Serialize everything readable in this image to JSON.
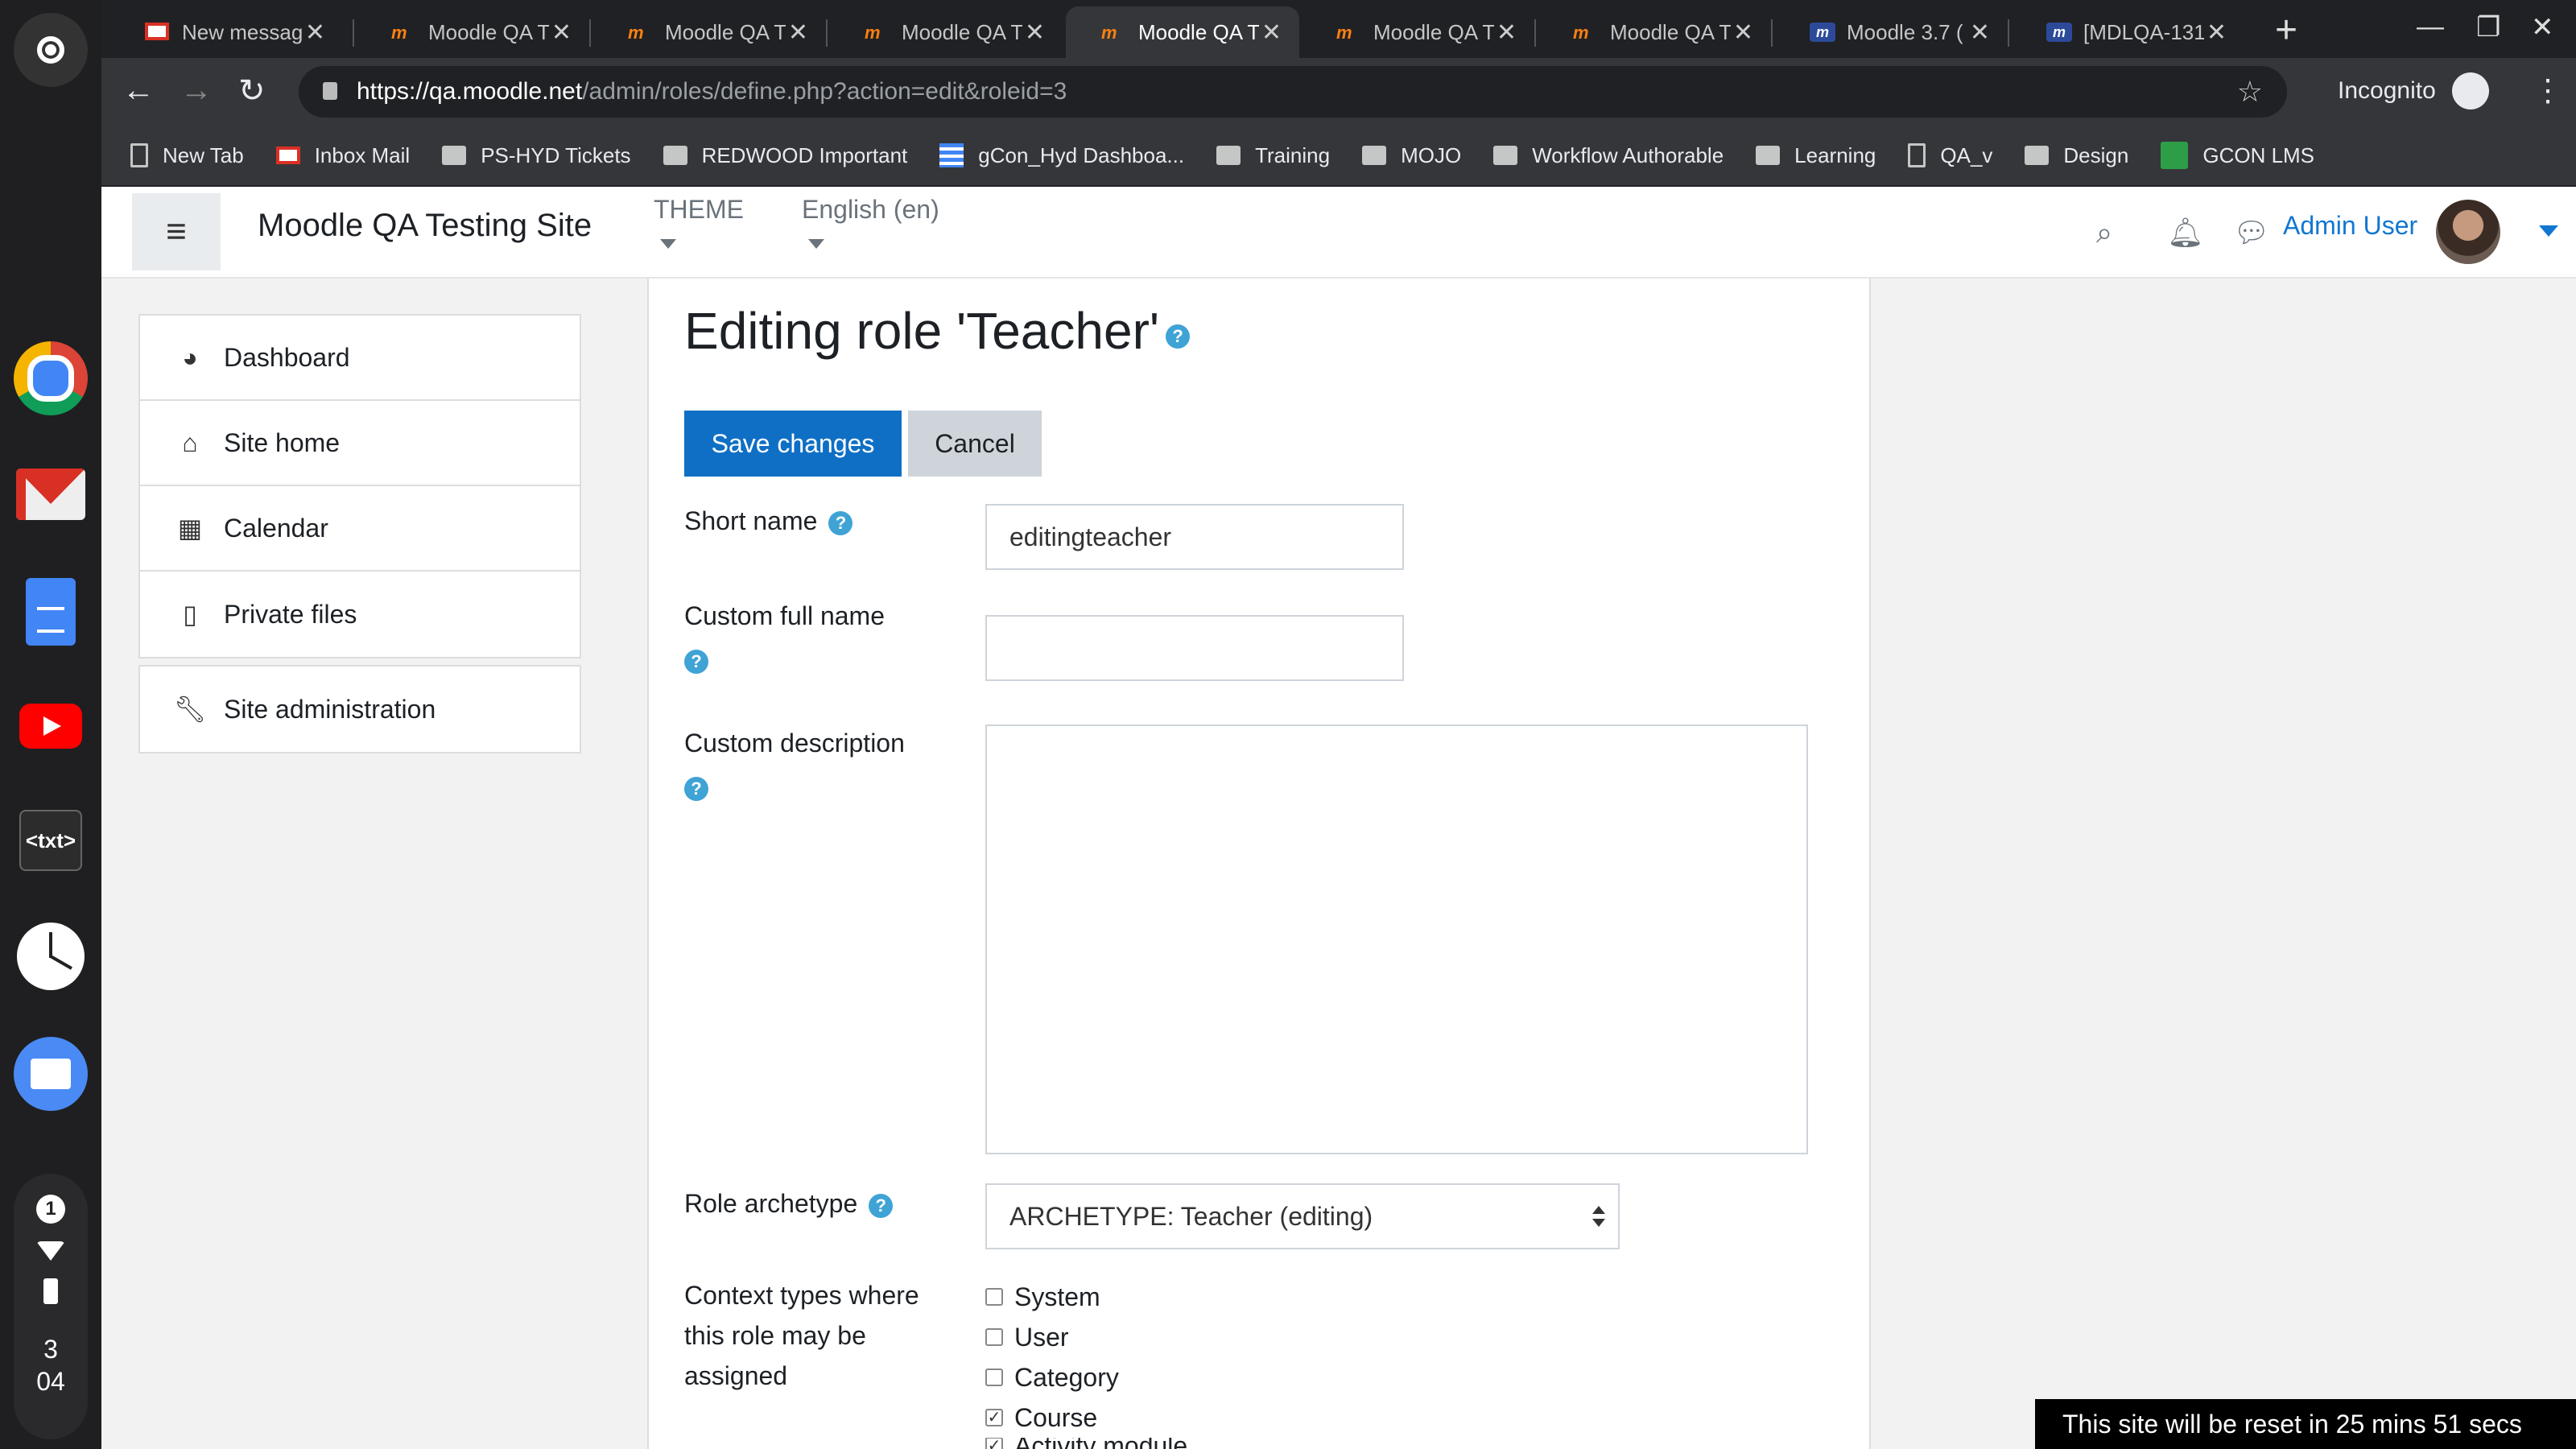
{
  "shelf": {
    "apps": [
      "launcher-icon",
      "chrome-icon",
      "gmail-icon",
      "docs-icon",
      "youtube-icon",
      "text-editor-icon",
      "clock-icon",
      "files-icon"
    ],
    "text_app_label": "<txt>",
    "notification_count": "1",
    "time_hour": "3",
    "time_minute": "04"
  },
  "browser": {
    "tabs": [
      {
        "title": "New message",
        "icon": "gmail-icon"
      },
      {
        "title": "Moodle QA T",
        "icon": "moodle-icon"
      },
      {
        "title": "Moodle QA T",
        "icon": "moodle-icon"
      },
      {
        "title": "Moodle QA T",
        "icon": "moodle-icon"
      },
      {
        "title": "Moodle QA T",
        "icon": "moodle-icon",
        "active": true
      },
      {
        "title": "Moodle QA T",
        "icon": "moodle-icon"
      },
      {
        "title": "Moodle QA T",
        "icon": "moodle-icon"
      },
      {
        "title": "Moodle 3.7 (",
        "icon": "moodle-tracker-icon"
      },
      {
        "title": "[MDLQA-131",
        "icon": "moodle-tracker-icon"
      }
    ],
    "url_host": "https://qa.moodle.net",
    "url_path": "/admin/roles/define.php?action=edit&roleid=3",
    "incognito_label": "Incognito",
    "bookmarks": [
      {
        "label": "New Tab",
        "icon": "page-icon"
      },
      {
        "label": "Inbox Mail",
        "icon": "gmail-icon"
      },
      {
        "label": "PS-HYD Tickets",
        "icon": "folder-icon"
      },
      {
        "label": "REDWOOD Important",
        "icon": "folder-icon"
      },
      {
        "label": "gCon_Hyd Dashboa...",
        "icon": "dashboard-icon"
      },
      {
        "label": "Training",
        "icon": "folder-icon"
      },
      {
        "label": "MOJO",
        "icon": "folder-icon"
      },
      {
        "label": "Workflow Authorable",
        "icon": "folder-icon"
      },
      {
        "label": "Learning",
        "icon": "folder-icon"
      },
      {
        "label": "QA_v",
        "icon": "page-icon"
      },
      {
        "label": "Design",
        "icon": "folder-icon"
      },
      {
        "label": "GCON LMS",
        "icon": "lms-icon"
      }
    ]
  },
  "moodle": {
    "site_name": "Moodle QA Testing Site",
    "theme_menu": "THEME",
    "language_menu": "English (en)",
    "user_name": "Admin User",
    "left_nav": {
      "main": [
        {
          "label": "Dashboard",
          "icon": "dashboard-icon"
        },
        {
          "label": "Site home",
          "icon": "home-icon"
        },
        {
          "label": "Calendar",
          "icon": "calendar-icon"
        },
        {
          "label": "Private files",
          "icon": "file-icon"
        }
      ],
      "admin": {
        "label": "Site administration",
        "icon": "wrench-icon"
      }
    },
    "form": {
      "heading": "Editing role 'Teacher'",
      "save_label": "Save changes",
      "cancel_label": "Cancel",
      "short_name_label": "Short name",
      "short_name_value": "editingteacher",
      "full_name_label": "Custom full name",
      "full_name_value": "",
      "description_label": "Custom description",
      "description_value": "",
      "archetype_label": "Role archetype",
      "archetype_value": "ARCHETYPE: Teacher (editing)",
      "context_label": "Context types where this role may be assigned",
      "contexts": [
        {
          "label": "System",
          "checked": false
        },
        {
          "label": "User",
          "checked": false
        },
        {
          "label": "Category",
          "checked": false
        },
        {
          "label": "Course",
          "checked": true
        },
        {
          "label": "Activity module",
          "checked": true
        }
      ]
    },
    "reset_notice": "This site will be reset in 25 mins 51 secs"
  }
}
